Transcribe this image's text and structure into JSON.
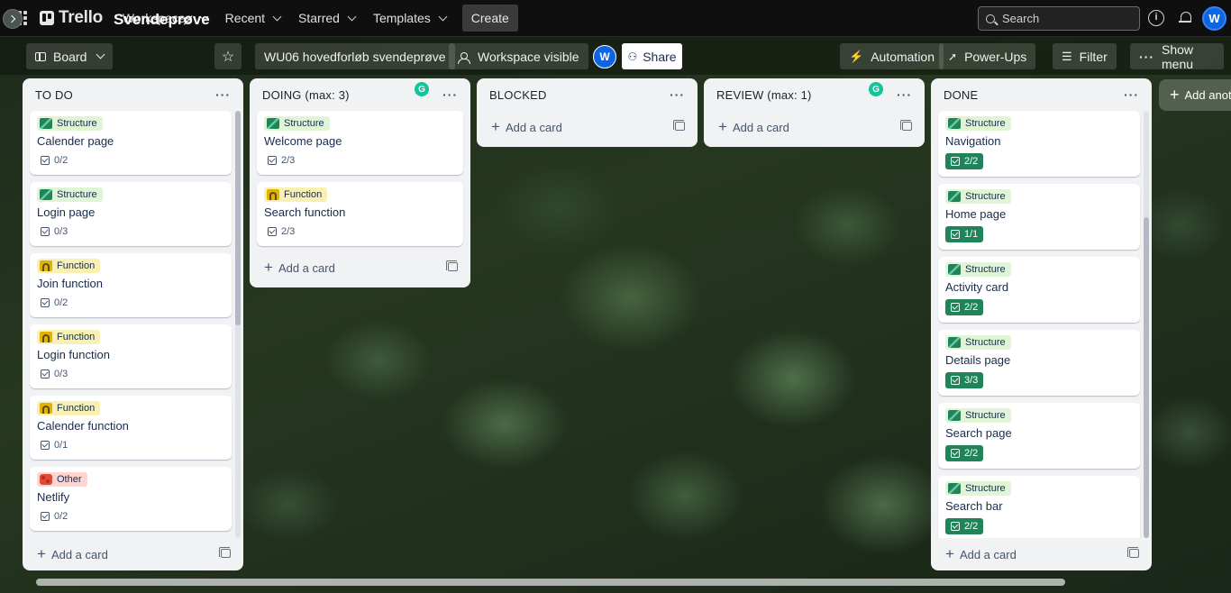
{
  "topbar": {
    "logo": "Trello",
    "nav": [
      "Workspaces",
      "Recent",
      "Starred",
      "Templates"
    ],
    "create": "Create",
    "search_placeholder": "Search",
    "avatar": "W"
  },
  "boardbar": {
    "view": "Board",
    "title": "Svendeprøve",
    "workspace": "WU06 hovedforløb svendeprøve",
    "visibility": "Workspace visible",
    "member_avatar": "W",
    "share": "Share",
    "automation": "Automation",
    "powerups": "Power-Ups",
    "filter": "Filter",
    "show_menu": "Show menu"
  },
  "lists": [
    {
      "title": "TO DO",
      "cards": [
        {
          "label": "Structure",
          "label_type": "structure",
          "title": "Calender page",
          "checklist": "0/2",
          "complete": false
        },
        {
          "label": "Structure",
          "label_type": "structure",
          "title": "Login page",
          "checklist": "0/3",
          "complete": false
        },
        {
          "label": "Function",
          "label_type": "function",
          "title": "Join function",
          "checklist": "0/2",
          "complete": false
        },
        {
          "label": "Function",
          "label_type": "function",
          "title": "Login function",
          "checklist": "0/3",
          "complete": false
        },
        {
          "label": "Function",
          "label_type": "function",
          "title": "Calender function",
          "checklist": "0/1",
          "complete": false
        },
        {
          "label": "Other",
          "label_type": "other",
          "title": "Netlify",
          "checklist": "0/2",
          "complete": false
        }
      ]
    },
    {
      "title": "DOING (max: 3)",
      "cards": [
        {
          "label": "Structure",
          "label_type": "structure",
          "title": "Welcome page",
          "checklist": "2/3",
          "complete": false
        },
        {
          "label": "Function",
          "label_type": "function",
          "title": "Search function",
          "checklist": "2/3",
          "complete": false
        }
      ]
    },
    {
      "title": "BLOCKED",
      "cards": []
    },
    {
      "title": "REVIEW (max: 1)",
      "cards": []
    },
    {
      "title": "DONE",
      "cards": [
        {
          "label": "Structure",
          "label_type": "structure",
          "title": "Navigation",
          "checklist": "2/2",
          "complete": true
        },
        {
          "label": "Structure",
          "label_type": "structure",
          "title": "Home page",
          "checklist": "1/1",
          "complete": true
        },
        {
          "label": "Structure",
          "label_type": "structure",
          "title": "Activity card",
          "checklist": "2/2",
          "complete": true
        },
        {
          "label": "Structure",
          "label_type": "structure",
          "title": "Details page",
          "checklist": "3/3",
          "complete": true
        },
        {
          "label": "Structure",
          "label_type": "structure",
          "title": "Search page",
          "checklist": "2/2",
          "complete": true
        },
        {
          "label": "Structure",
          "label_type": "structure",
          "title": "Search bar",
          "checklist": "2/2",
          "complete": true
        }
      ]
    }
  ],
  "add_card": "Add a card",
  "add_list": "Add another list",
  "colors": {
    "structure_label": "#dff5d6",
    "function_label": "#f8f1b3",
    "other_label": "#ffd5d2",
    "complete_badge": "#1f845a",
    "accent": "#0c66e4"
  }
}
